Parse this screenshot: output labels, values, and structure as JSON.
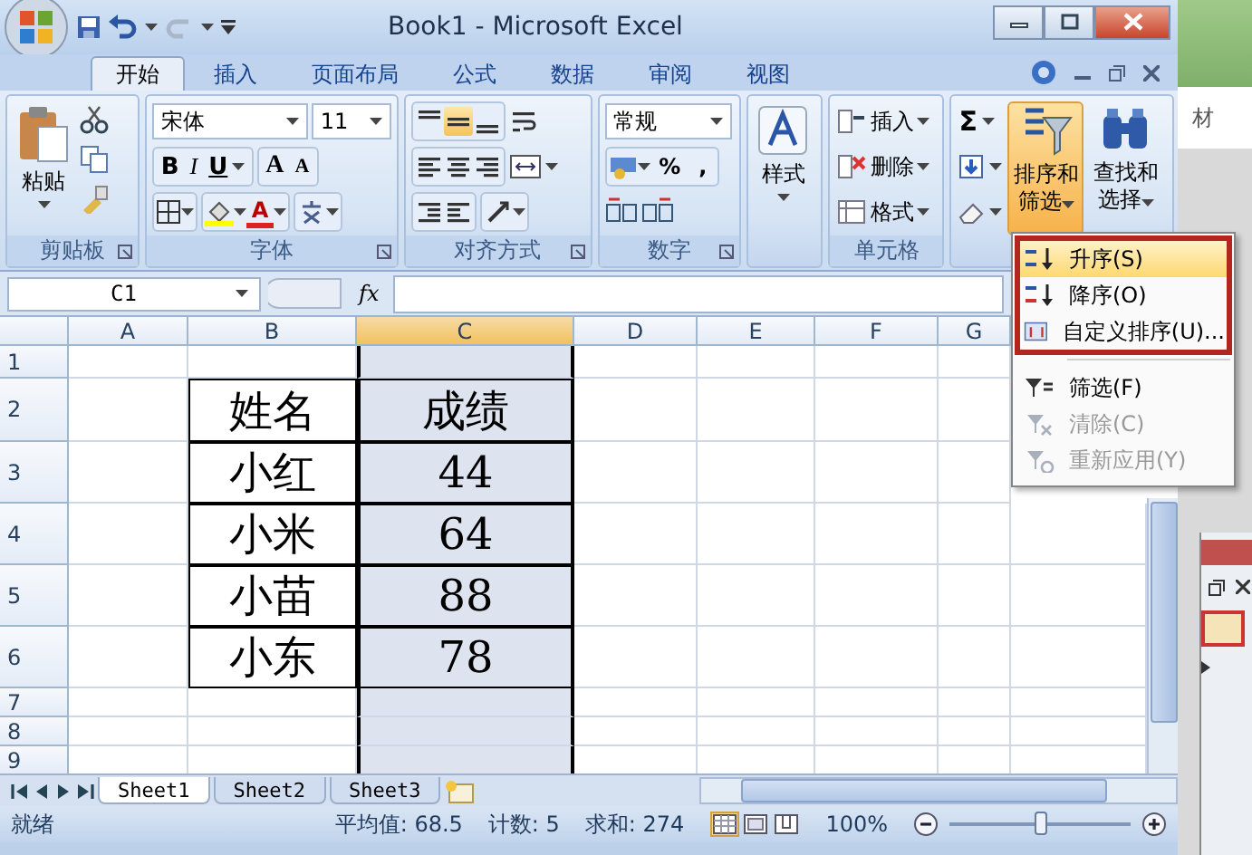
{
  "window": {
    "title": "Book1 - Microsoft Excel"
  },
  "ribbon_tabs": [
    {
      "label": "开始",
      "selected": true
    },
    {
      "label": "插入",
      "selected": false
    },
    {
      "label": "页面布局",
      "selected": false
    },
    {
      "label": "公式",
      "selected": false
    },
    {
      "label": "数据",
      "selected": false
    },
    {
      "label": "审阅",
      "selected": false
    },
    {
      "label": "视图",
      "selected": false
    }
  ],
  "ribbon": {
    "groups": [
      {
        "kind": "clipboard",
        "label": "剪贴板",
        "paste": "粘贴"
      },
      {
        "kind": "font",
        "label": "字体",
        "font_name": "宋体",
        "font_size": "11",
        "style_buttons": [
          "B",
          "I",
          "U"
        ],
        "size_buttons": [
          "A",
          "A"
        ],
        "font_color": "A"
      },
      {
        "kind": "alignment",
        "label": "对齐方式",
        "vertical_align": [
          {
            "selected": false
          },
          {
            "selected": true
          },
          {
            "selected": false
          }
        ]
      },
      {
        "kind": "number",
        "label": "数字",
        "format": "常规",
        "symbols": [
          "%",
          ","
        ]
      },
      {
        "kind": "styles",
        "button": "样式"
      },
      {
        "kind": "cells",
        "label": "单元格",
        "buttons": [
          "插入",
          "删除",
          "格式"
        ]
      },
      {
        "kind": "editing",
        "sum": "Σ",
        "sort": {
          "label": "排序和筛选",
          "expanded": true
        },
        "find": "查找和选择"
      }
    ]
  },
  "formula_bar": {
    "name_box": "C1",
    "fx": "fx"
  },
  "sheet": {
    "columns": [
      {
        "label": "A",
        "selected": false
      },
      {
        "label": "B",
        "selected": false
      },
      {
        "label": "C",
        "selected": true
      },
      {
        "label": "D",
        "selected": false
      },
      {
        "label": "E",
        "selected": false
      },
      {
        "label": "F",
        "selected": false
      },
      {
        "label": "G",
        "selected": false
      }
    ],
    "rows": [
      "1",
      "2",
      "3",
      "4",
      "5",
      "6",
      "7",
      "8",
      "9"
    ],
    "table": {
      "headers": [
        "姓名",
        "成绩"
      ],
      "records": [
        [
          "小红",
          "44"
        ],
        [
          "小米",
          "64"
        ],
        [
          "小苗",
          "88"
        ],
        [
          "小东",
          "78"
        ]
      ]
    }
  },
  "sheet_tabs": [
    {
      "label": "Sheet1",
      "selected": true
    },
    {
      "label": "Sheet2",
      "selected": false
    },
    {
      "label": "Sheet3",
      "selected": false
    }
  ],
  "status_bar": {
    "status": "就绪",
    "stats": [
      "平均值: 68.5",
      "计数: 5",
      "求和: 274"
    ],
    "views": [
      {
        "kind": "normal",
        "selected": true
      },
      {
        "kind": "page_layout",
        "selected": false
      },
      {
        "kind": "page_break",
        "selected": false
      }
    ],
    "zoom": "100%",
    "zoom_slider": {
      "level": 0.5
    }
  },
  "sort_menu": {
    "groups": [
      {
        "boxed": true,
        "items": [
          {
            "kind": "ascending",
            "label": "升序(S)",
            "selected": true,
            "disabled": false
          },
          {
            "kind": "descending",
            "label": "降序(O)",
            "selected": false,
            "disabled": false
          },
          {
            "kind": "custom",
            "label": "自定义排序(U)...",
            "selected": false,
            "disabled": false
          }
        ]
      },
      {
        "boxed": false,
        "items": [
          {
            "kind": "filter",
            "label": "筛选(F)",
            "selected": false,
            "disabled": false
          },
          {
            "kind": "clear",
            "label": "清除(C)",
            "selected": false,
            "disabled": true
          },
          {
            "kind": "reapply",
            "label": "重新应用(Y)",
            "selected": false,
            "disabled": true
          }
        ]
      }
    ]
  },
  "background_window": {
    "text": "材"
  }
}
